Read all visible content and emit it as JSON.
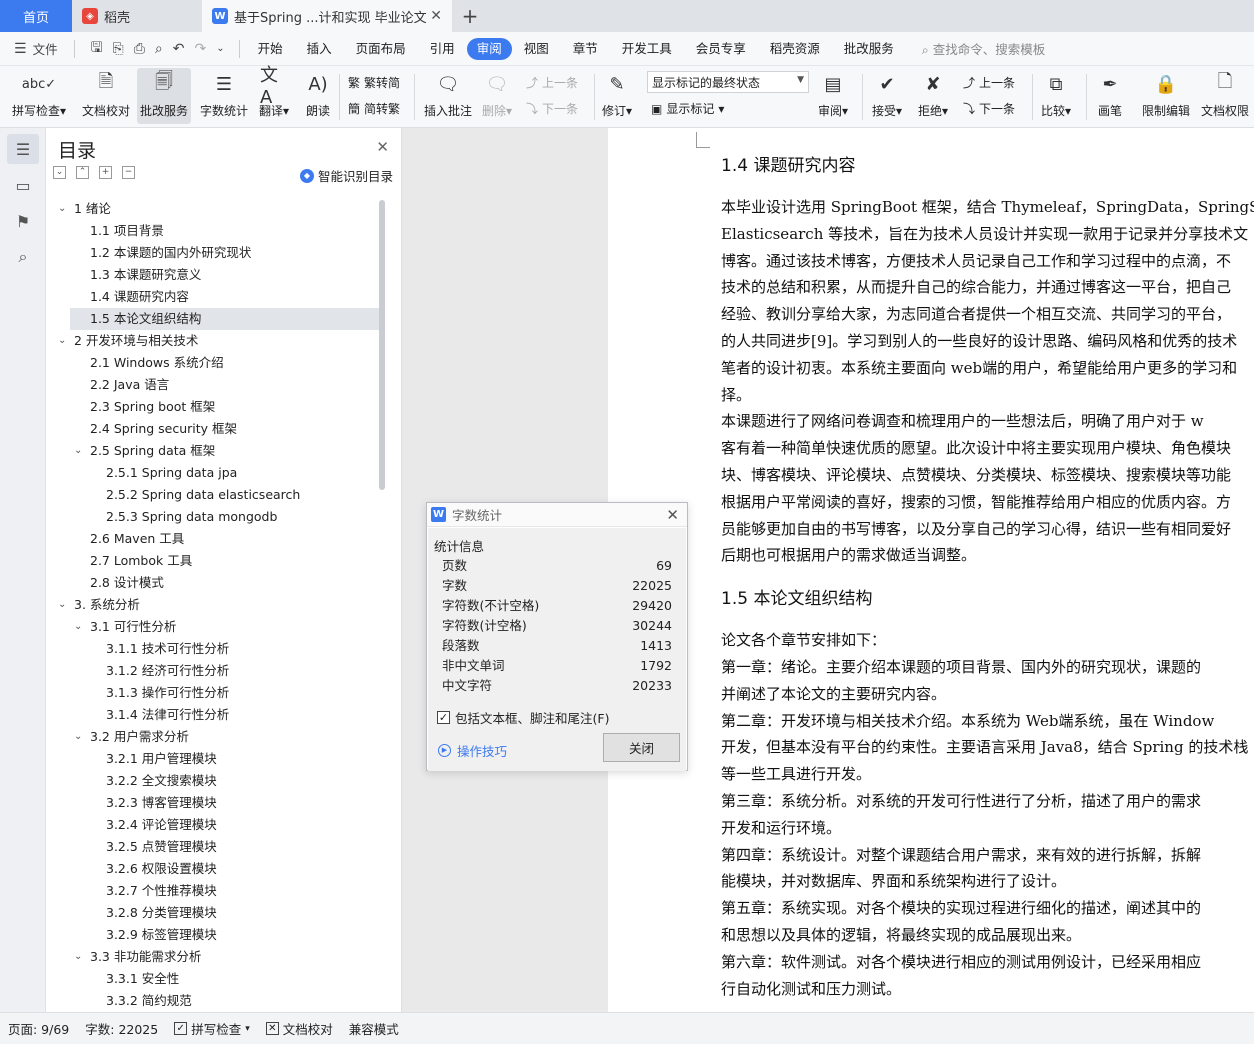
{
  "tabs": {
    "home": "首页",
    "daoke": "稻壳",
    "doc": "基于Spring ...计和实现 毕业论文",
    "doc_close": "✕",
    "add": "+"
  },
  "menu": {
    "file": "文件",
    "items": [
      "开始",
      "插入",
      "页面布局",
      "引用",
      "审阅",
      "视图",
      "章节",
      "开发工具",
      "会员专享",
      "稻壳资源",
      "批改服务"
    ],
    "active": "审阅",
    "search": "查找命令、搜索模板"
  },
  "ribbon": {
    "spell": "拼写检查",
    "doc_check": "文档校对",
    "review_service": "批改服务",
    "word_count": "字数统计",
    "translate": "翻译",
    "read_aloud": "朗读",
    "to_trad": "繁转简",
    "to_simp": "简转繁",
    "insert_comment": "插入批注",
    "delete": "删除",
    "prev": "上一条",
    "next": "下一条",
    "track": "修订",
    "show_mode": "显示标记的最终状态",
    "show_markup": "显示标记",
    "review": "审阅",
    "accept": "接受",
    "reject": "拒绝",
    "prev2": "上一条",
    "next2": "下一条",
    "compare": "比较",
    "pen": "画笔",
    "restrict": "限制编辑",
    "doc_perm": "文档权限"
  },
  "toc": {
    "title": "目录",
    "smart": "智能识别目录",
    "items": [
      {
        "level": 1,
        "text": "1  绪论",
        "expanded": true
      },
      {
        "level": 2,
        "text": "1.1  项目背景"
      },
      {
        "level": 2,
        "text": "1.2  本课题的国内外研究现状"
      },
      {
        "level": 2,
        "text": "1.3  本课题研究意义"
      },
      {
        "level": 2,
        "text": "1.4  课题研究内容"
      },
      {
        "level": 2,
        "text": "1.5  本论文组织结构",
        "selected": true
      },
      {
        "level": 1,
        "text": "2  开发环境与相关技术",
        "expanded": true
      },
      {
        "level": 2,
        "text": "2.1 Windows 系统介绍"
      },
      {
        "level": 2,
        "text": "2.2 Java 语言"
      },
      {
        "level": 2,
        "text": "2.3 Spring boot 框架"
      },
      {
        "level": 2,
        "text": "2.4 Spring security  框架"
      },
      {
        "level": 2,
        "text": "2.5 Spring data  框架",
        "expanded": true
      },
      {
        "level": 3,
        "text": "2.5.1 Spring data jpa"
      },
      {
        "level": 3,
        "text": "2.5.2 Spring data elasticsearch"
      },
      {
        "level": 3,
        "text": "2.5.3 Spring data mongodb"
      },
      {
        "level": 2,
        "text": "2.6 Maven  工具"
      },
      {
        "level": 2,
        "text": "2.7 Lombok  工具"
      },
      {
        "level": 2,
        "text": "2.8  设计模式"
      },
      {
        "level": 1,
        "text": "3.  系统分析",
        "expanded": true
      },
      {
        "level": 2,
        "text": "3.1  可行性分析",
        "expanded": true
      },
      {
        "level": 3,
        "text": "3.1.1  技术可行性分析"
      },
      {
        "level": 3,
        "text": "3.1.2  经济可行性分析"
      },
      {
        "level": 3,
        "text": "3.1.3  操作可行性分析"
      },
      {
        "level": 3,
        "text": "3.1.4  法律可行性分析"
      },
      {
        "level": 2,
        "text": "3.2  用户需求分析",
        "expanded": true
      },
      {
        "level": 3,
        "text": "3.2.1  用户管理模块"
      },
      {
        "level": 3,
        "text": "3.2.2  全文搜索模块"
      },
      {
        "level": 3,
        "text": "3.2.3  博客管理模块"
      },
      {
        "level": 3,
        "text": "3.2.4  评论管理模块"
      },
      {
        "level": 3,
        "text": "3.2.5  点赞管理模块"
      },
      {
        "level": 3,
        "text": "3.2.6  权限设置模块"
      },
      {
        "level": 3,
        "text": "3.2.7  个性推荐模块"
      },
      {
        "level": 3,
        "text": "3.2.8 分类管理模块"
      },
      {
        "level": 3,
        "text": "3.2.9 标签管理模块"
      },
      {
        "level": 2,
        "text": "3.3  非功能需求分析",
        "expanded": true
      },
      {
        "level": 3,
        "text": "3.3.1  安全性"
      },
      {
        "level": 3,
        "text": "3.3.2  简约规范"
      }
    ]
  },
  "document": {
    "heading1": "1.4  课题研究内容",
    "para1": [
      "    本毕业设计选用 SpringBoot 框架，结合 Thymeleaf，SpringData，SpringS",
      "Elasticsearch 等技术，旨在为技术人员设计并实现一款用于记录并分享技术文",
      "博客。通过该技术博客，方便技术人员记录自己工作和学习过程中的点滴，不",
      "技术的总结和积累，从而提升自己的综合能力，并通过博客这一平台，把自己",
      "经验、教训分享给大家，为志同道合者提供一个相互交流、共同学习的平台，",
      "的人共同进步[9]。学习到别人的一些良好的设计思路、编码风格和优秀的技术",
      "笔者的设计初衷。本系统主要面向 web端的用户，希望能给用户更多的学习和",
      "择。",
      "    本课题进行了网络问卷调查和梳理用户的一些想法后，明确了用户对于 w",
      "客有着一种简单快速优质的愿望。此次设计中将主要实现用户模块、角色模块",
      "块、博客模块、评论模块、点赞模块、分类模块、标签模块、搜索模块等功能",
      "根据用户平常阅读的喜好，搜索的习惯，智能推荐给用户相应的优质内容。方",
      "员能够更加自由的书写博客，以及分享自己的学习心得，结识一些有相同爱好",
      "后期也可根据用户的需求做适当调整。"
    ],
    "heading2": "1.5  本论文组织结构",
    "para2": [
      "    论文各个章节安排如下：",
      "    第一章：绪论。主要介绍本课题的项目背景、国内外的研究现状，课题的",
      "并阐述了本论文的主要研究内容。",
      "    第二章：开发环境与相关技术介绍。本系统为 Web端系统，虽在 Window",
      "开发，但基本没有平台的约束性。主要语言采用 Java8，结合 Spring 的技术栈",
      "等一些工具进行开发。",
      "    第三章：系统分析。对系统的开发可行性进行了分析，描述了用户的需求",
      "开发和运行环境。",
      "    第四章：系统设计。对整个课题结合用户需求，来有效的进行拆解，拆解",
      "能模块，并对数据库、界面和系统架构进行了设计。",
      "    第五章：系统实现。对各个模块的实现过程进行细化的描述，阐述其中的",
      "和思想以及具体的逻辑，将最终实现的成品展现出来。",
      "    第六章：软件测试。对各个模块进行相应的测试用例设计，已经采用相应",
      "行自动化测试和压力测试。"
    ]
  },
  "dialog": {
    "title": "字数统计",
    "section": "统计信息",
    "stats": [
      {
        "label": "页数",
        "value": "69"
      },
      {
        "label": "字数",
        "value": "22025"
      },
      {
        "label": "字符数(不计空格)",
        "value": "29420"
      },
      {
        "label": "字符数(计空格)",
        "value": "30244"
      },
      {
        "label": "段落数",
        "value": "1413"
      },
      {
        "label": "非中文单词",
        "value": "1792"
      },
      {
        "label": "中文字符",
        "value": "20233"
      }
    ],
    "checkbox": "包括文本框、脚注和尾注(F)",
    "checkbox_checked": true,
    "tips": "操作技巧",
    "close_btn": "关闭"
  },
  "status": {
    "page": "页面: 9/69",
    "words": "字数: 22025",
    "spell": "拼写检查",
    "doc_check": "文档校对",
    "compat": "兼容模式"
  },
  "colors": {
    "accent": "#3c7af0",
    "daoke": "#e8453c"
  }
}
